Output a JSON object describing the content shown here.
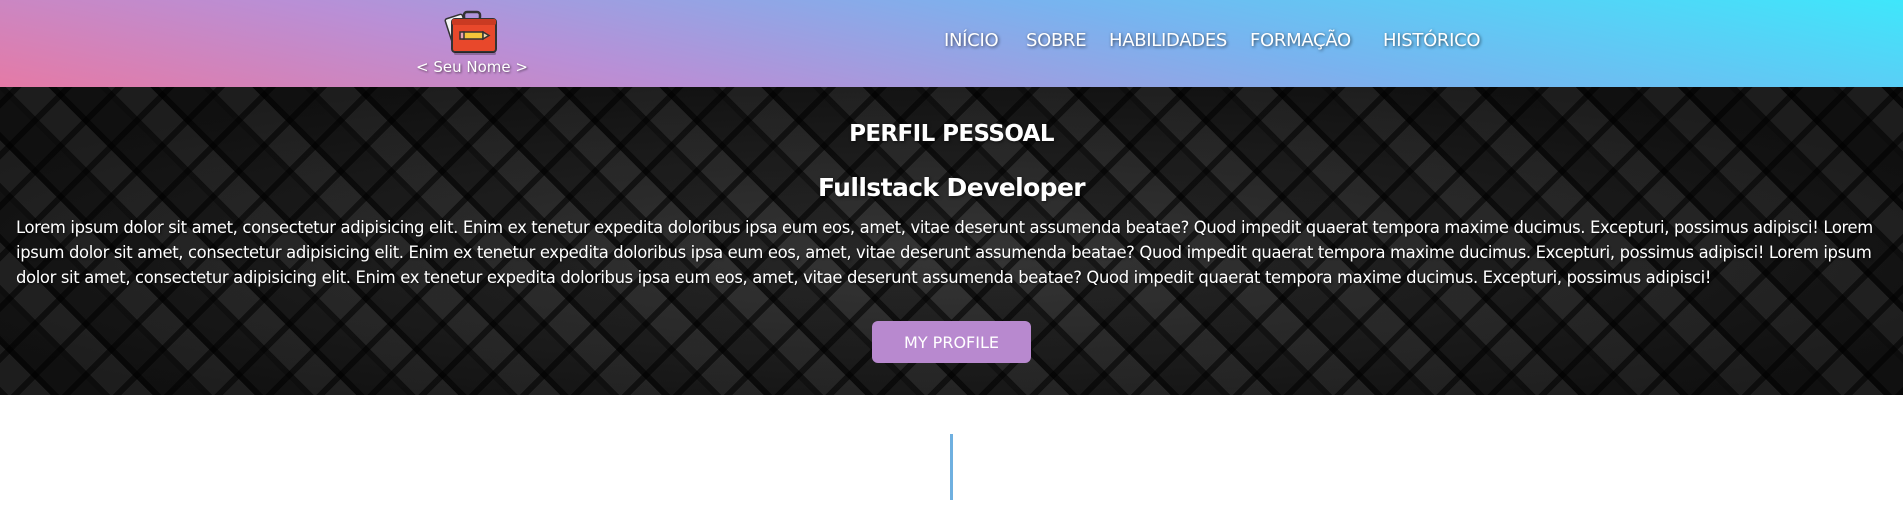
{
  "brand": {
    "name": "< Seu Nome >",
    "logo_icon": "briefcase-pencil-icon"
  },
  "nav": {
    "items": [
      {
        "label": "INÍCIO"
      },
      {
        "label": "SOBRE"
      },
      {
        "label": "HABILIDADES"
      },
      {
        "label": "FORMAÇÃO"
      },
      {
        "label": "HISTÓRICO"
      }
    ]
  },
  "hero": {
    "title": "PERFIL PESSOAL",
    "subtitle": "Fullstack Developer",
    "text": "Lorem ipsum dolor sit amet, consectetur adipisicing elit. Enim ex tenetur expedita doloribus ipsa eum eos, amet, vitae deserunt assumenda beatae? Quod impedit quaerat tempora maxime ducimus. Excepturi, possimus adipisci! Lorem ipsum dolor sit amet, consectetur adipisicing elit. Enim ex tenetur expedita doloribus ipsa eum eos, amet, vitae deserunt assumenda beatae? Quod impedit quaerat tempora maxime ducimus. Excepturi, possimus adipisci! Lorem ipsum dolor sit amet, consectetur adipisicing elit. Enim ex tenetur expedita doloribus ipsa eum eos, amet, vitae deserunt assumenda beatae? Quod impedit quaerat tempora maxime ducimus. Excepturi, possimus adipisci!",
    "button_label": "MY PROFILE"
  },
  "colors": {
    "accent_button": "#b889cf",
    "divider": "#6fb0e0",
    "nav_gradient_start": "#e57aa6",
    "nav_gradient_end": "#3ee7fb"
  }
}
